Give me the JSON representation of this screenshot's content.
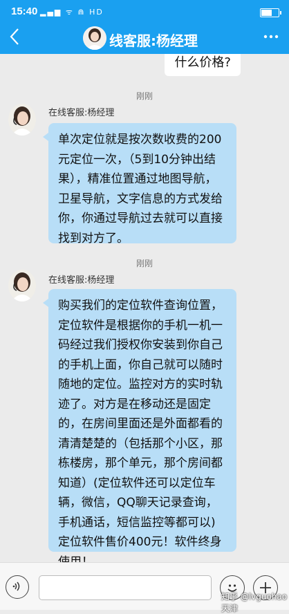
{
  "status_bar": {
    "time": "15:40",
    "indicators": "▂▄▆ ᯤ ⋒ HD",
    "battery_level": 0.7
  },
  "header": {
    "title": "线客服:杨经理",
    "back_icon": "chevron-left-icon",
    "more_icon": "more-dots-icon"
  },
  "messages": {
    "outgoing_partial": "什么价格?",
    "items": [
      {
        "time": "刚刚",
        "sender": "在线客服:杨经理",
        "text": "单次定位就是按次数收费的200元定位一次，（5到10分钟出结果），精准位置通过地图导航，卫星导航，文字信息的方式发给你，你通过导航过去就可以直接找到对方了。"
      },
      {
        "time": "刚刚",
        "sender": "在线客服:杨经理",
        "text": "购买我们的定位软件查询位置，定位软件是根据你的手机一机一码经过我们授权你安装到你自己的手机上面，你自己就可以随时随地的定位。监控对方的实时轨迹了。对方是在移动还是固定的，在房间里面还是外面都看的清清楚楚的（包括那个小区，那栋楼房，那个单元，那个房间都知道）(定位软件还可以定位车辆，微信，QQ聊天记录查询，手机通话，短信监控等都可以)定位软件售价400元！软件终身使用！"
      }
    ]
  },
  "input_bar": {
    "placeholder": "",
    "voice_icon": "voice-icon",
    "emoji_icon": "emoji-icon",
    "plus_icon": "plus-icon"
  },
  "watermark": "知乎 @lvguohao天津",
  "colors": {
    "header": "#1aa0f0",
    "bubble_in": "#b8def7"
  }
}
